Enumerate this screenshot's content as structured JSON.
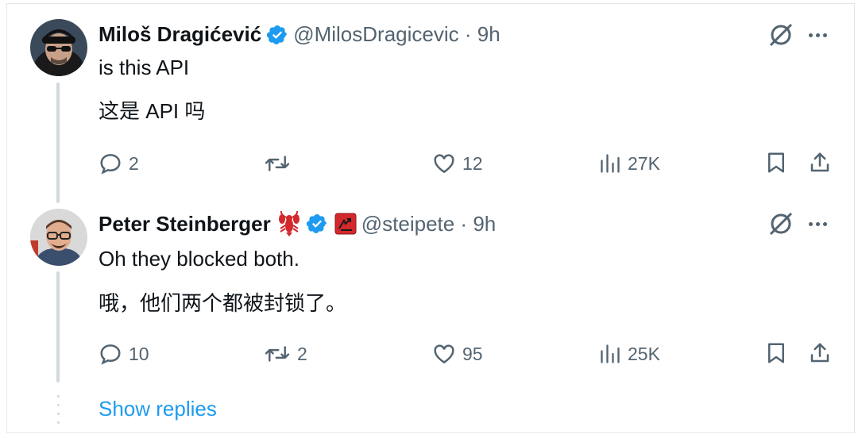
{
  "tweets": [
    {
      "name": "Miloš Dragićević",
      "handle": "@MilosDragicevic · 9h",
      "lines": [
        "is this API",
        "这是 API 吗"
      ],
      "replies": "2",
      "reposts": "",
      "likes": "12",
      "views": "27K"
    },
    {
      "name": "Peter Steinberger",
      "handle": "@steipete · 9h",
      "lines": [
        "Oh  they blocked both.",
        "哦，他们两个都被封锁了。"
      ],
      "replies": "10",
      "reposts": "2",
      "likes": "95",
      "views": "25K"
    }
  ],
  "show_replies": "Show replies",
  "colors": {
    "verified": "#1d9bf0",
    "icon": "#536471",
    "thread_line": "#cfd9de",
    "link": "#1d9bf0"
  },
  "icons": {
    "top_right": [
      "grok-icon",
      "more-icon"
    ],
    "actions": [
      "reply-icon",
      "repost-icon",
      "like-icon",
      "views-icon",
      "bookmark-icon",
      "share-icon"
    ],
    "badges": [
      "verified-badge-icon",
      "lobster-emoji-icon",
      "red-affiliate-badge-icon"
    ]
  }
}
